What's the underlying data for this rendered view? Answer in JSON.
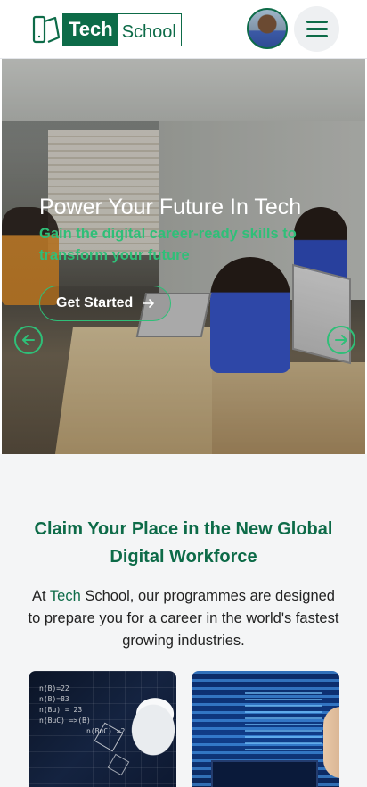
{
  "header": {
    "logo_tech": "Tech",
    "logo_school": "School",
    "avatar_icon": "user-avatar",
    "menu_icon": "hamburger-icon",
    "brand_color": "#0d6b48"
  },
  "hero": {
    "title": "Power Your Future In Tech",
    "subtitle": "Gain the digital career-ready skills to transform your future",
    "cta_label": "Get Started",
    "cta_icon": "arrow-right-icon",
    "prev_icon": "arrow-left-circle-icon",
    "next_icon": "arrow-right-circle-icon",
    "accent_color": "#2fbf78"
  },
  "section": {
    "title": "Claim Your Place in the New Global Digital Workforce",
    "text_before": "At ",
    "text_brand": "Tech",
    "text_after": " School, our programmes are designed to prepare you for a career in the world's fastest growing industries.",
    "cards": [
      {
        "icon": "ai-robot-image"
      },
      {
        "icon": "developer-screens-image"
      }
    ]
  }
}
